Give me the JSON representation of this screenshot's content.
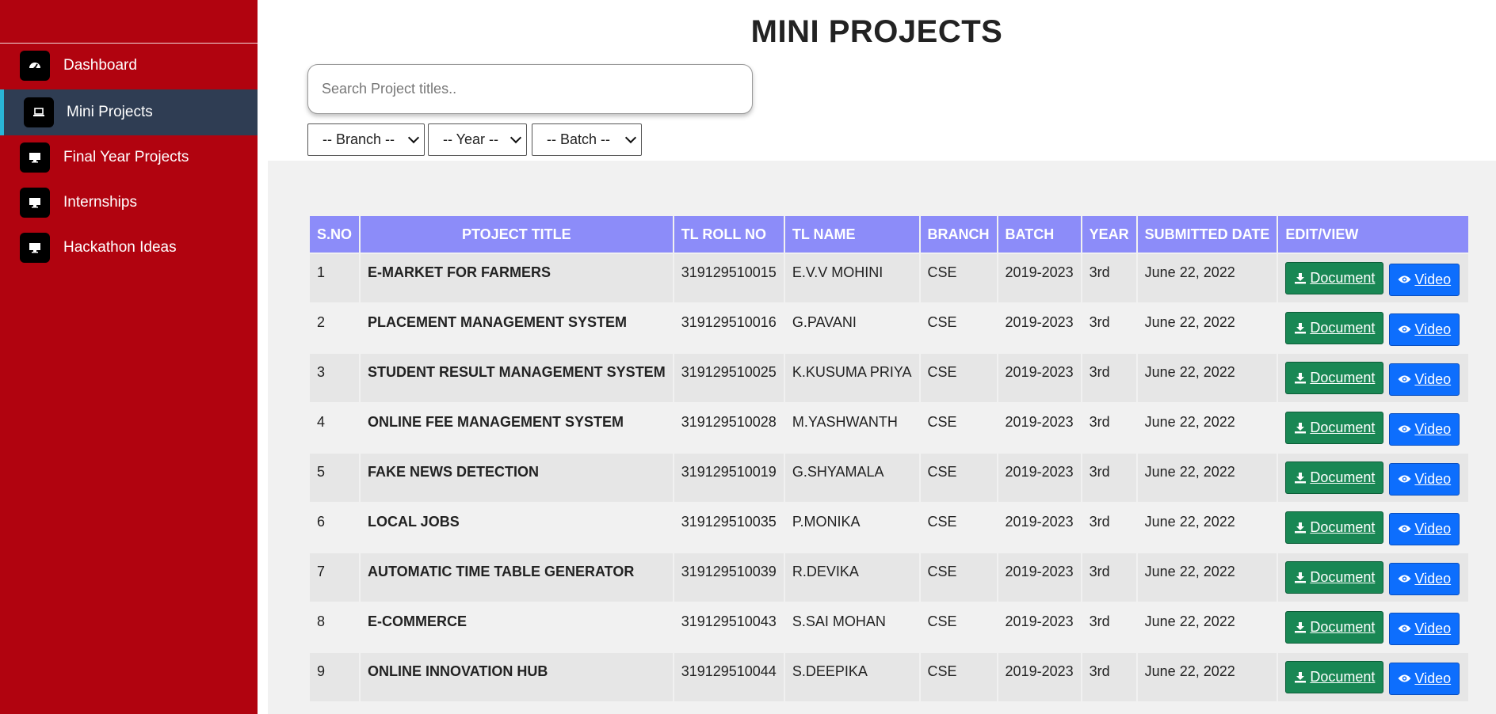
{
  "sidebar": {
    "items": [
      {
        "label": "Dashboard",
        "icon": "speedometer-icon"
      },
      {
        "label": "Mini Projects",
        "icon": "laptop-icon",
        "active": true
      },
      {
        "label": "Final Year Projects",
        "icon": "desktop-icon"
      },
      {
        "label": "Internships",
        "icon": "desktop-icon"
      },
      {
        "label": "Hackathon Ideas",
        "icon": "desktop-icon"
      }
    ]
  },
  "main": {
    "title": "MINI PROJECTS",
    "search_placeholder": "Search Project titles..",
    "filters": {
      "branch": "-- Branch --",
      "year": "-- Year --",
      "batch": "-- Batch --"
    },
    "table": {
      "headers": [
        "S.NO",
        "PTOJECT TITLE",
        "TL ROLL NO",
        "TL NAME",
        "BRANCH",
        "BATCH",
        "YEAR",
        "SUBMITTED DATE",
        "EDIT/VIEW"
      ],
      "document_label": "Document",
      "video_label": "Video",
      "rows": [
        {
          "sno": "1",
          "title": "E-MARKET FOR FARMERS",
          "roll": "319129510015",
          "name": "E.V.V MOHINI",
          "branch": "CSE",
          "batch": "2019-2023",
          "year": "3rd",
          "date": "June 22, 2022"
        },
        {
          "sno": "2",
          "title": "PLACEMENT MANAGEMENT SYSTEM",
          "roll": "319129510016",
          "name": "G.PAVANI",
          "branch": "CSE",
          "batch": "2019-2023",
          "year": "3rd",
          "date": "June 22, 2022"
        },
        {
          "sno": "3",
          "title": "STUDENT RESULT MANAGEMENT SYSTEM",
          "roll": "319129510025",
          "name": "K.KUSUMA PRIYA",
          "branch": "CSE",
          "batch": "2019-2023",
          "year": "3rd",
          "date": "June 22, 2022"
        },
        {
          "sno": "4",
          "title": "ONLINE FEE MANAGEMENT SYSTEM",
          "roll": "319129510028",
          "name": "M.YASHWANTH",
          "branch": "CSE",
          "batch": "2019-2023",
          "year": "3rd",
          "date": "June 22, 2022"
        },
        {
          "sno": "5",
          "title": "FAKE NEWS DETECTION",
          "roll": "319129510019",
          "name": "G.SHYAMALA",
          "branch": "CSE",
          "batch": "2019-2023",
          "year": "3rd",
          "date": "June 22, 2022"
        },
        {
          "sno": "6",
          "title": "LOCAL JOBS",
          "roll": "319129510035",
          "name": "P.MONIKA",
          "branch": "CSE",
          "batch": "2019-2023",
          "year": "3rd",
          "date": "June 22, 2022"
        },
        {
          "sno": "7",
          "title": "AUTOMATIC TIME TABLE GENERATOR",
          "roll": "319129510039",
          "name": "R.DEVIKA",
          "branch": "CSE",
          "batch": "2019-2023",
          "year": "3rd",
          "date": "June 22, 2022"
        },
        {
          "sno": "8",
          "title": "E-COMMERCE",
          "roll": "319129510043",
          "name": "S.SAI MOHAN",
          "branch": "CSE",
          "batch": "2019-2023",
          "year": "3rd",
          "date": "June 22, 2022"
        },
        {
          "sno": "9",
          "title": "ONLINE INNOVATION HUB",
          "roll": "319129510044",
          "name": "S.DEEPIKA",
          "branch": "CSE",
          "batch": "2019-2023",
          "year": "3rd",
          "date": "June 22, 2022"
        }
      ]
    }
  },
  "colors": {
    "sidebar_bg": "#b1030f",
    "sidebar_active_bg": "#2f3d53",
    "sidebar_active_accent": "#29b6d7",
    "table_header_bg": "#8c8cf9",
    "document_button": "#198754",
    "video_button": "#0d6efd"
  }
}
